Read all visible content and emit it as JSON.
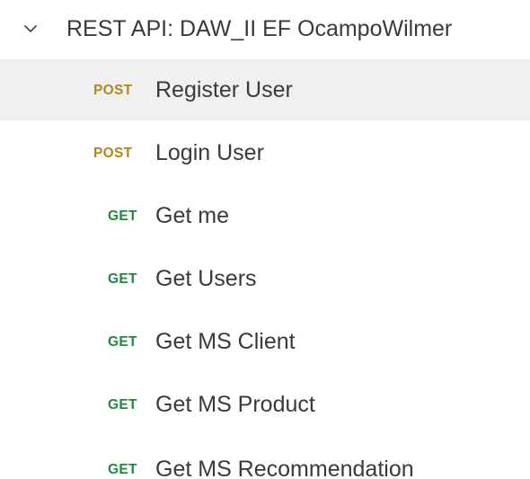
{
  "collection": {
    "name": "REST API: DAW_II EF OcampoWilmer",
    "icon": "chevron-down-icon"
  },
  "requests": [
    {
      "method": "POST",
      "name": "Register User",
      "selected": true
    },
    {
      "method": "POST",
      "name": "Login User",
      "selected": false
    },
    {
      "method": "GET",
      "name": "Get me",
      "selected": false
    },
    {
      "method": "GET",
      "name": "Get Users",
      "selected": false
    },
    {
      "method": "GET",
      "name": "Get MS Client",
      "selected": false
    },
    {
      "method": "GET",
      "name": "Get MS Product",
      "selected": false
    },
    {
      "method": "GET",
      "name": "Get MS Recommendation",
      "selected": false
    }
  ],
  "colors": {
    "post": "#b0881a",
    "get": "#1f8a3f",
    "selected_bg": "#f0f0f0",
    "text": "#3a3a3a"
  }
}
